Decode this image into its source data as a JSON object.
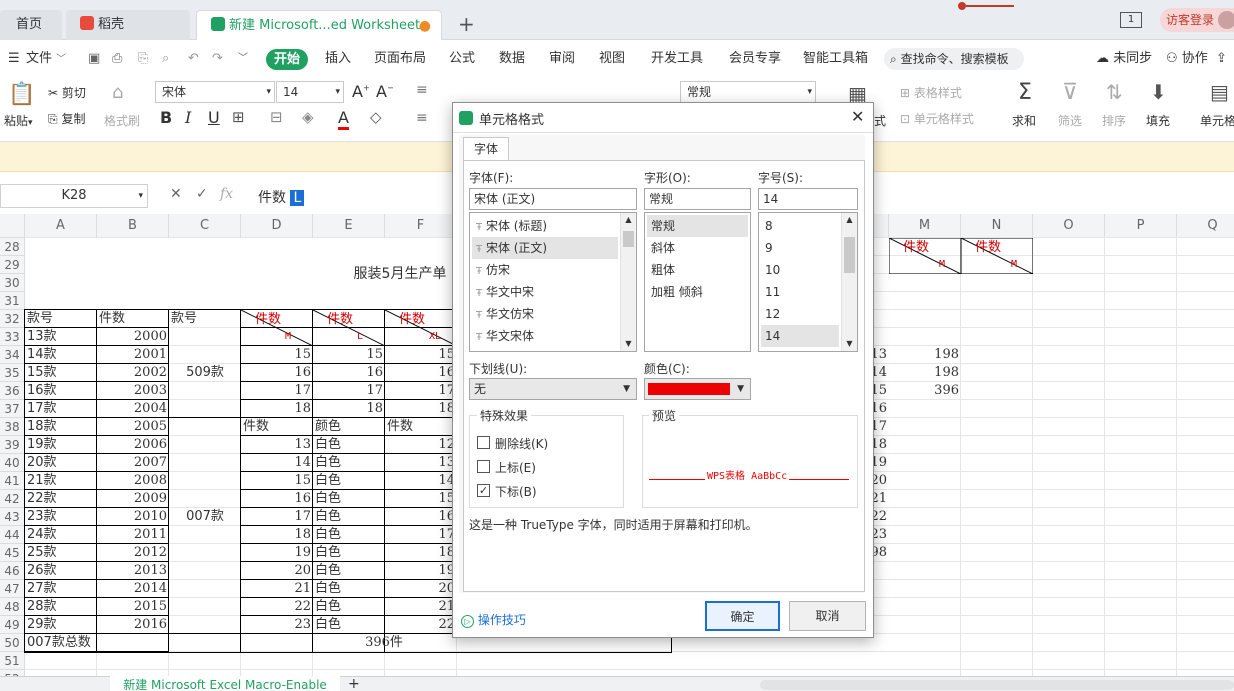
{
  "titlebar": {
    "tab_home": "首页",
    "tab_daoke": "稻壳",
    "tab_doc": "新建 Microsoft...ed Worksheet",
    "new_tab": "+",
    "login": "访客登录",
    "page_badge": "1"
  },
  "menu": {
    "file": "文件",
    "items": [
      "开始",
      "插入",
      "页面布局",
      "公式",
      "数据",
      "审阅",
      "视图",
      "开发工具",
      "会员专享",
      "智能工具箱"
    ],
    "search": "查找命令、搜索模板",
    "sync": "未同步",
    "collab": "协作"
  },
  "ribbon": {
    "paste": "粘贴",
    "cut": "剪切",
    "copy": "复制",
    "format_painter": "格式刷",
    "font_name": "宋体",
    "font_size": "14",
    "number_format": "常规",
    "table_style": "表格样式",
    "cell_style": "单元格样式",
    "sum": "求和",
    "filter": "筛选",
    "sort": "排序",
    "fill": "填充",
    "cell": "单元格",
    "bold": "B",
    "italic": "I",
    "underline": "U",
    "grow_font": "A",
    "shrink_font": "A",
    "font_color": "A",
    "format_frag": "式"
  },
  "formula": {
    "name_box": "K28",
    "cancel": "✕",
    "confirm": "✓",
    "fx": "fx",
    "content": "件数",
    "selected": "L"
  },
  "grid": {
    "columns": [
      "A",
      "B",
      "C",
      "D",
      "E",
      "F",
      "M",
      "N",
      "O",
      "P",
      "Q"
    ],
    "rows": [
      "28",
      "29",
      "30",
      "31",
      "32",
      "33",
      "34",
      "35",
      "36",
      "37",
      "38",
      "39",
      "40",
      "41",
      "42",
      "43",
      "44",
      "45",
      "46",
      "47",
      "48",
      "49",
      "50",
      "51",
      "52"
    ],
    "title": "服装5月生产单",
    "header_row": [
      "款号",
      "件数",
      "款号"
    ],
    "red_header": [
      "件数",
      "件数",
      "件数"
    ],
    "size_marks": [
      "M",
      "L",
      "XL"
    ],
    "m_header": [
      "件数",
      "件数"
    ],
    "m_sizes": [
      "M",
      "M"
    ],
    "styles": [
      "13款",
      "14款",
      "15款",
      "16款",
      "17款",
      "18款",
      "19款",
      "20款",
      "21款",
      "22款",
      "23款",
      "24款",
      "25款",
      "26款",
      "27款",
      "28款",
      "29款"
    ],
    "years": [
      "2000",
      "2001",
      "2002",
      "2003",
      "2004",
      "2005",
      "2006",
      "2007",
      "2008",
      "2009",
      "2010",
      "2011",
      "2012",
      "2013",
      "2014",
      "2015",
      "2016"
    ],
    "group_509": "509款",
    "group_007": "007款",
    "d_values": [
      "15",
      "16",
      "17",
      "18"
    ],
    "e_values": [
      "15",
      "16",
      "17",
      "18"
    ],
    "f_values": [
      "15",
      "16",
      "17",
      "18"
    ],
    "d_header_38": "件数",
    "e_header_38": "颜色",
    "f_header_38": "件数",
    "d_lower": [
      "13",
      "14",
      "15",
      "16",
      "17",
      "18",
      "19",
      "20",
      "21",
      "22",
      "23"
    ],
    "color_text": "白色",
    "f_lower": [
      "12",
      "13",
      "14",
      "15",
      "16",
      "17",
      "18",
      "19",
      "20",
      "21",
      "22"
    ],
    "m_values": [
      "198",
      "198",
      "396"
    ],
    "hidden_col_values": [
      "13",
      "14",
      "15",
      "16",
      "17",
      "18",
      "19",
      "20",
      "21",
      "22",
      "23",
      "98"
    ],
    "total_label": "007款总数",
    "total_value": "396件",
    "sheet_tab": "新建 Microsoft Excel Macro-Enable",
    "add_sheet": "+"
  },
  "dialog": {
    "title": "单元格格式",
    "close": "✕",
    "tab_font": "字体",
    "font_label": "字体(F):",
    "font_value": "宋体 (正文)",
    "fonts": [
      "宋体 (标题)",
      "宋体 (正文)",
      "仿宋",
      "华文中宋",
      "华文仿宋",
      "华文宋体"
    ],
    "style_label": "字形(O):",
    "style_value": "常规",
    "styles": [
      "常规",
      "斜体",
      "粗体",
      "加粗 倾斜"
    ],
    "size_label": "字号(S):",
    "size_value": "14",
    "sizes": [
      "8",
      "9",
      "10",
      "11",
      "12",
      "14"
    ],
    "underline_label": "下划线(U):",
    "underline_value": "无",
    "color_label": "颜色(C):",
    "color_hex": "#ee0000",
    "effects_label": "特殊效果",
    "strike_label": "删除线(K)",
    "superscript_label": "上标(E)",
    "subscript_label": "下标(B)",
    "subscript_checked": "✓",
    "preview_label": "预览",
    "preview_text": "WPS表格  AaBbCc",
    "description": "这是一种 TrueType 字体，同时适用于屏幕和打印机。",
    "tips": "操作技巧",
    "ok": "确定",
    "cancel": "取消"
  },
  "colors": {
    "accent_green": "#20a162",
    "red_text": "#d40000",
    "dialog_red": "#ee0000"
  }
}
